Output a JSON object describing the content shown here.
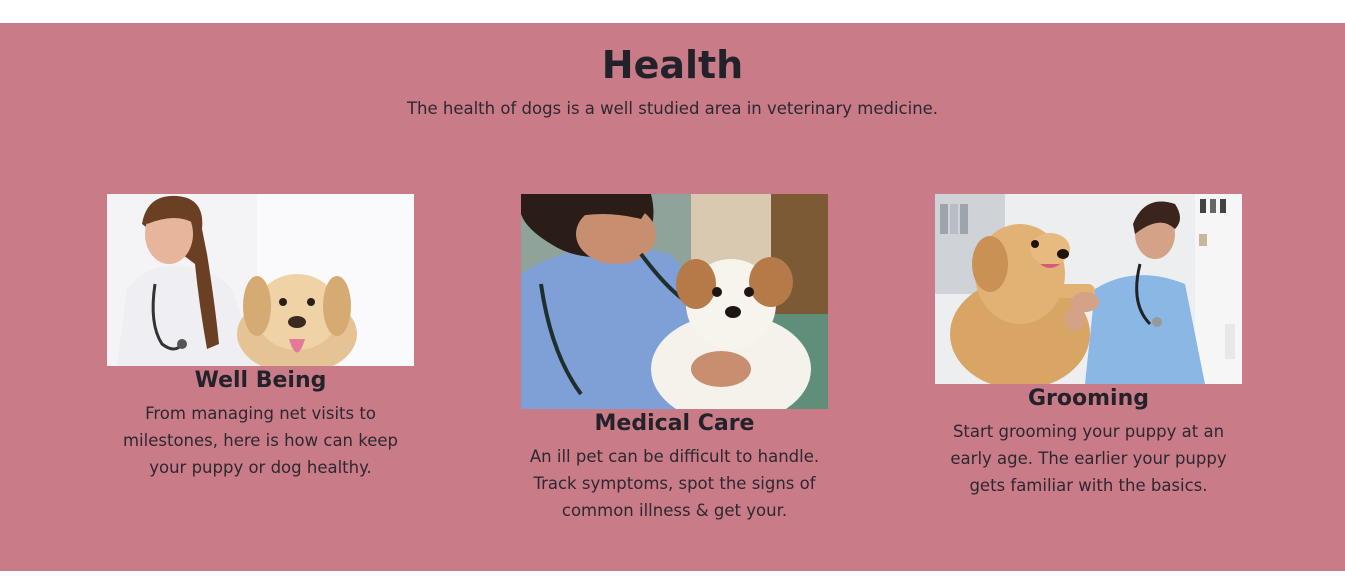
{
  "health": {
    "title": "Health",
    "subtitle": "The health of dogs is a well studied area in veterinary medicine.",
    "background": "#c97c88"
  },
  "cards": [
    {
      "heading": "Well Being",
      "text": "From managing net visits to milestones, here is how can keep your puppy or dog healthy.",
      "image": "vet-woman-with-labrador-photo"
    },
    {
      "heading": "Medical Care",
      "text": "An ill pet can be difficult to handle. Track symptoms, spot the signs of common illness & get your.",
      "image": "vet-holding-terrier-photo"
    },
    {
      "heading": "Grooming",
      "text": "Start grooming your puppy at an early age. The earlier your puppy gets familiar with the basics.",
      "image": "vet-trimming-golden-retriever-nails-photo"
    }
  ]
}
